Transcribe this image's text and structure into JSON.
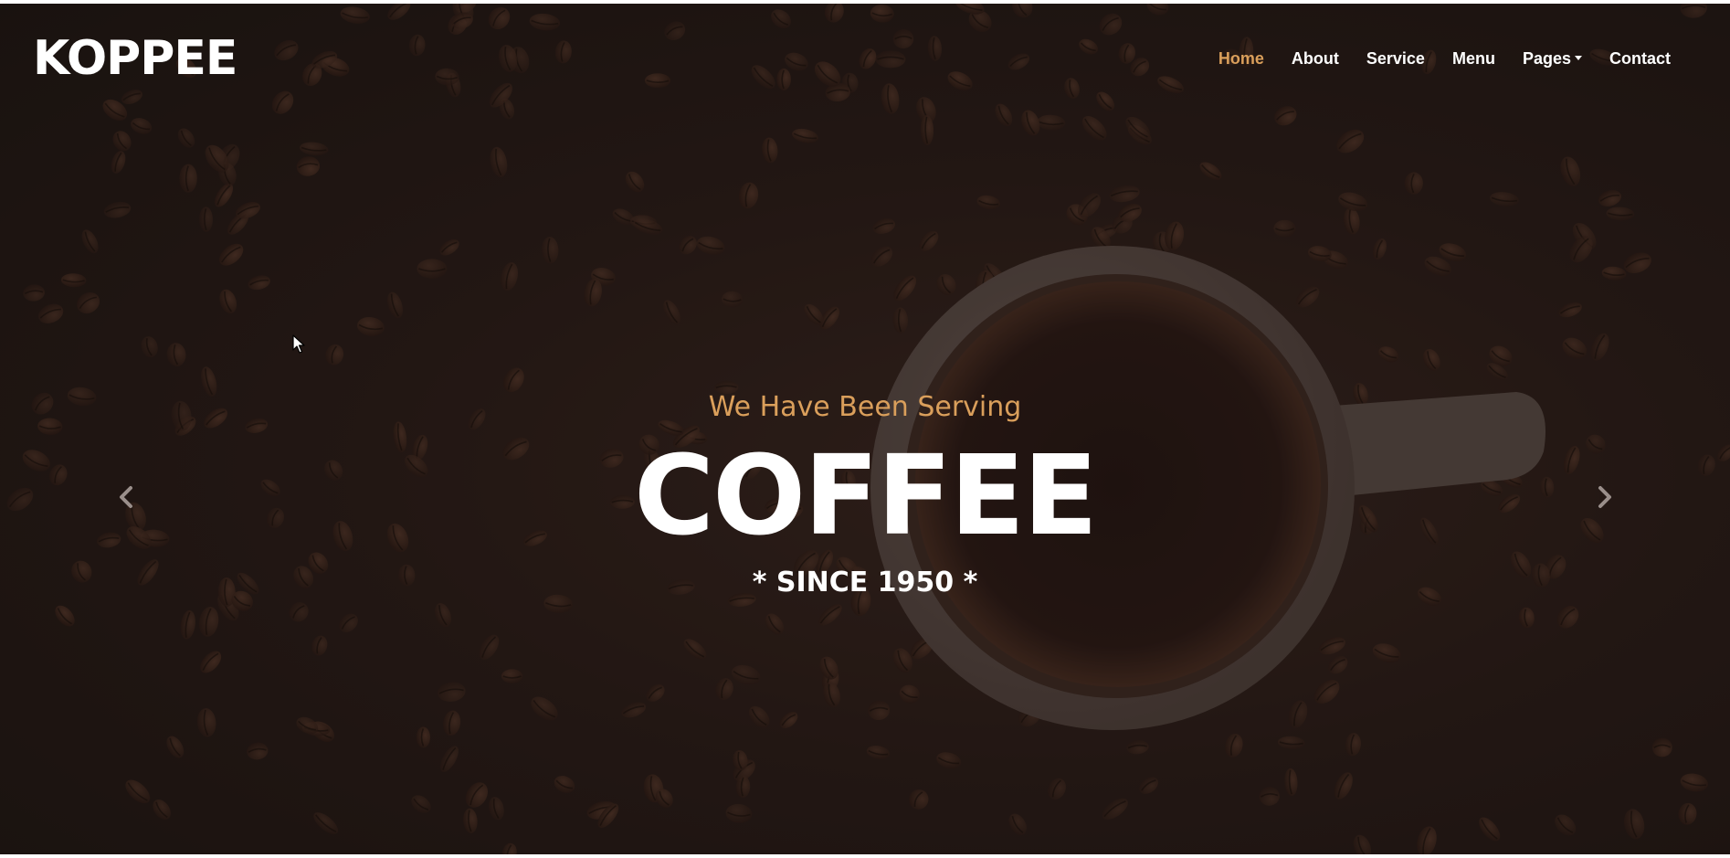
{
  "brand": {
    "name": "KOPPEE"
  },
  "nav": {
    "items": [
      {
        "label": "Home",
        "active": true
      },
      {
        "label": "About"
      },
      {
        "label": "Service"
      },
      {
        "label": "Menu"
      },
      {
        "label": "Pages",
        "has_dropdown": true
      },
      {
        "label": "Contact"
      }
    ]
  },
  "hero": {
    "subtitle": "We Have Been Serving",
    "headline": "COFFEE",
    "since": "* SINCE 1950 *"
  },
  "carousel": {
    "prev_icon": "chevron-left-icon",
    "next_icon": "chevron-right-icon"
  },
  "colors": {
    "accent": "#DA9F5B",
    "text": "#FFFFFF",
    "background": "#2A1C18"
  }
}
